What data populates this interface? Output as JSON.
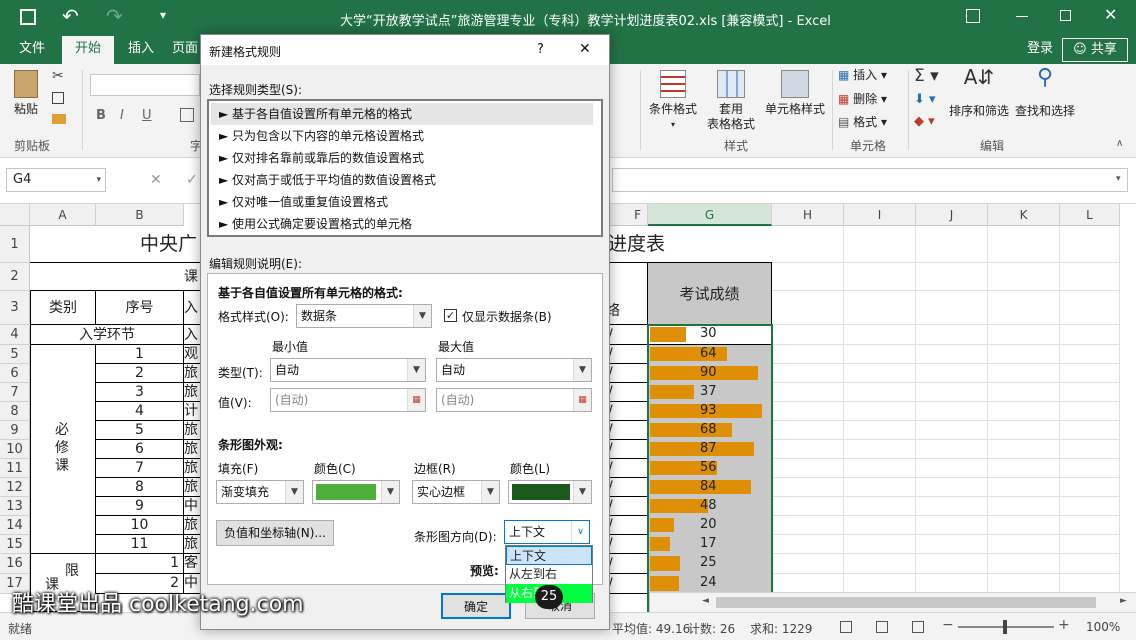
{
  "window": {
    "title": "大学“开放教学试点”旅游管理专业（专科）教学计划进度表02.xls  [兼容模式] - Excel"
  },
  "qat": {
    "undo": "↶",
    "save": "▪"
  },
  "tabs": [
    {
      "label": "文件"
    },
    {
      "label": "开始"
    },
    {
      "label": "插入"
    },
    {
      "label": "页面"
    }
  ],
  "account": {
    "login": "登录",
    "share": "共享"
  },
  "ribbon": {
    "paste": "粘贴",
    "clipboard_group": "剪贴板",
    "font_group_partial": "字",
    "cond_format": "条件格式",
    "table_format_1": "套用",
    "table_format_2": "表格格式",
    "cell_style": "单元格样式",
    "styles_group": "样式",
    "insert": "插入",
    "delete": "删除",
    "format": "格式",
    "cells_group": "单元格",
    "sort_filter": "排序和筛选",
    "find_select": "查找和选择",
    "edit_group": "编辑",
    "bold": "B",
    "italic": "I",
    "underline": "U"
  },
  "formula_bar": {
    "name_box": "G4",
    "cancel": "✕",
    "confirm": "✓"
  },
  "columns": [
    "A",
    "B",
    "F",
    "G",
    "H",
    "I",
    "J",
    "K",
    "L"
  ],
  "rows": [
    "1",
    "2",
    "3",
    "4",
    "5",
    "6",
    "7",
    "8",
    "9",
    "10",
    "11",
    "12",
    "13",
    "14",
    "15",
    "16",
    "17"
  ],
  "sheet": {
    "title_left": "中央广",
    "title_right": "进度表",
    "row2_partial": "课",
    "category": "类别",
    "seq": "序号",
    "row3_c_partial": "入",
    "row3_f_partial": "络",
    "exam_header": "考试成绩",
    "entry": "入学环节",
    "entry_c_partial": "入",
    "required_label": "必修课",
    "limited_1": "限",
    "limited_2": "课",
    "seq_numbers": [
      "1",
      "2",
      "3",
      "4",
      "5",
      "6",
      "7",
      "8",
      "9",
      "10",
      "11"
    ],
    "col_c_partials": [
      "观",
      "旅",
      "旅",
      "计",
      "旅",
      "旅",
      "旅",
      "旅",
      "中",
      "旅",
      "旅"
    ],
    "row16_seq": "1",
    "row16_c": "客",
    "row17_seq": "2",
    "row17_c": "中",
    "f_marks": [
      "/",
      "/",
      "/",
      "/",
      "/",
      "/",
      "/",
      "/",
      "/",
      "/",
      "/",
      "/",
      "/",
      "/",
      "/"
    ],
    "scores": [
      30,
      64,
      90,
      37,
      93,
      68,
      87,
      56,
      84,
      48,
      20,
      17,
      25,
      24
    ],
    "score_max": 100
  },
  "dialog": {
    "title": "新建格式规则",
    "help": "?",
    "close": "✕",
    "select_type_label": "选择规则类型(S):",
    "rule_types": [
      "►  基于各自值设置所有单元格的格式",
      "►  只为包含以下内容的单元格设置格式",
      "►  仅对排名靠前或靠后的数值设置格式",
      "►  仅对高于或低于平均值的数值设置格式",
      "►  仅对唯一值或重复值设置格式",
      "►  使用公式确定要设置格式的单元格"
    ],
    "edit_desc_label": "编辑规则说明(E):",
    "section_title": "基于各自值设置所有单元格的格式:",
    "style_label": "格式样式(O):",
    "style_value": "数据条",
    "show_bar_only": "仅显示数据条(B)",
    "min_label": "最小值",
    "max_label": "最大值",
    "type_label": "类型(T):",
    "min_type": "自动",
    "max_type": "自动",
    "value_label": "值(V):",
    "min_value_placeholder": "(自动)",
    "max_value_placeholder": "(自动)",
    "bar_appearance": "条形图外观:",
    "fill_label": "填充(F)",
    "color_label": "颜色(C)",
    "border_label": "边框(R)",
    "border_color_label": "颜色(L)",
    "fill_value": "渐变填充",
    "border_value": "实心边框",
    "fill_color": "#4caf3a",
    "border_color": "#1e5a1e",
    "neg_axis_button": "负值和坐标轴(N)...",
    "direction_label": "条形图方向(D):",
    "direction_value": "上下文",
    "direction_options": [
      "上下文",
      "从左到右",
      "从右到左"
    ],
    "preview_label": "预览:",
    "ok": "确定",
    "cancel": "取消"
  },
  "step_badge": "25",
  "status": {
    "ready": "就绪",
    "average": "平均值: 49.16",
    "count": "计数: 26",
    "sum": "求和: 1229",
    "zoom": "100%"
  },
  "watermark": "酷课堂出品 coolketang.com",
  "accent_color": "#217346"
}
